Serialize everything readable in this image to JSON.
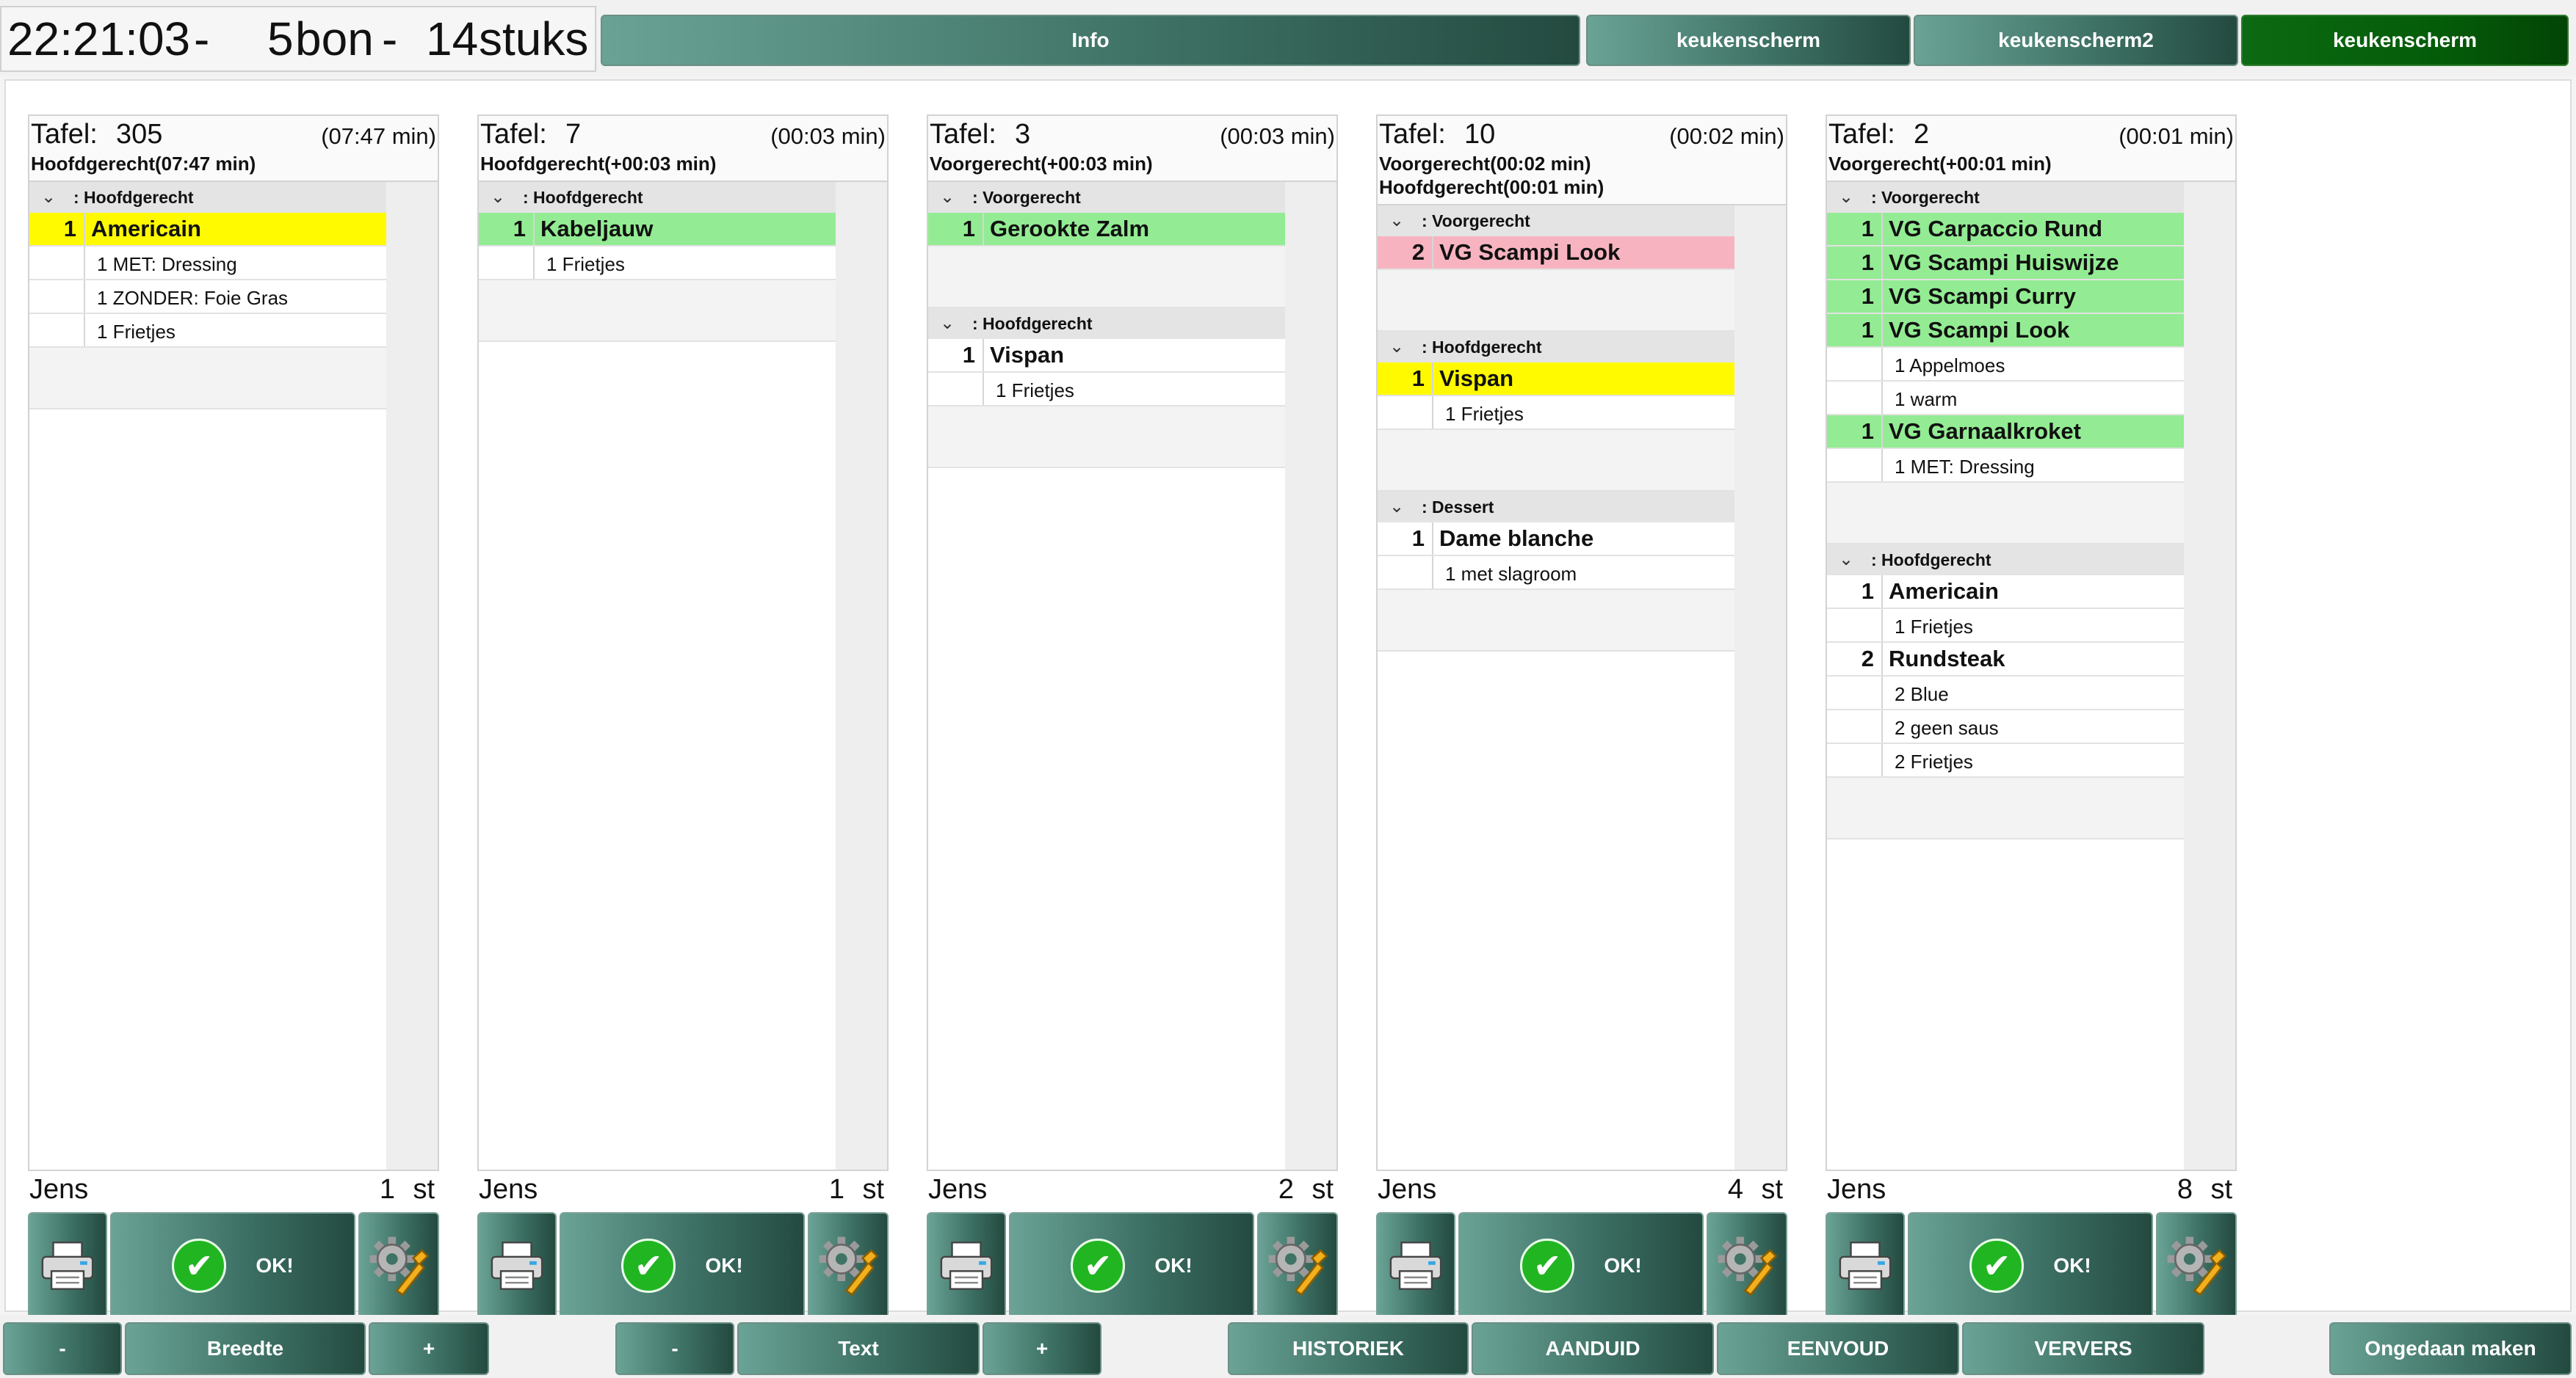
{
  "header": {
    "clock": "22:21:03",
    "dash": "-",
    "bon_count": "5",
    "bon_label": "bon",
    "pieces_count": "14",
    "pieces_label": "stuks",
    "buttons": [
      {
        "label": "Info",
        "active": false
      },
      {
        "label": "keukenscherm",
        "active": false
      },
      {
        "label": "keukenscherm2",
        "active": false
      },
      {
        "label": "keukenscherm",
        "active": true
      }
    ]
  },
  "tickets": [
    {
      "tafel_label": "Tafel:",
      "tafel": "305",
      "elapsed": "(07:47 min)",
      "course_lines": [
        "Hoofdgerecht(07:47 min)"
      ],
      "groups": [
        {
          "title": ": Hoofdgerecht",
          "items": [
            {
              "qty": "1",
              "name": "Americain",
              "highlight": "yellow",
              "subs": [
                "1 MET: Dressing",
                "1 ZONDER: Foie Gras",
                "1 Frietjes"
              ]
            }
          ]
        }
      ],
      "user": "Jens",
      "count": "1",
      "unit": "st",
      "ok_label": "OK!"
    },
    {
      "tafel_label": "Tafel:",
      "tafel": "7",
      "elapsed": "(00:03 min)",
      "course_lines": [
        "Hoofdgerecht(+00:03 min)"
      ],
      "groups": [
        {
          "title": ": Hoofdgerecht",
          "items": [
            {
              "qty": "1",
              "name": "Kabeljauw",
              "highlight": "green",
              "subs": [
                "1 Frietjes"
              ]
            }
          ]
        }
      ],
      "user": "Jens",
      "count": "1",
      "unit": "st",
      "ok_label": "OK!"
    },
    {
      "tafel_label": "Tafel:",
      "tafel": "3",
      "elapsed": "(00:03 min)",
      "course_lines": [
        "Voorgerecht(+00:03 min)"
      ],
      "groups": [
        {
          "title": ": Voorgerecht",
          "items": [
            {
              "qty": "1",
              "name": "Gerookte Zalm",
              "highlight": "green",
              "subs": []
            }
          ]
        },
        {
          "title": ": Hoofdgerecht",
          "items": [
            {
              "qty": "1",
              "name": "Vispan",
              "highlight": "",
              "subs": [
                "1 Frietjes"
              ]
            }
          ]
        }
      ],
      "user": "Jens",
      "count": "2",
      "unit": "st",
      "ok_label": "OK!"
    },
    {
      "tafel_label": "Tafel:",
      "tafel": "10",
      "elapsed": "(00:02 min)",
      "course_lines": [
        "Voorgerecht(00:02 min)",
        "Hoofdgerecht(00:01 min)"
      ],
      "groups": [
        {
          "title": ": Voorgerecht",
          "items": [
            {
              "qty": "2",
              "name": "VG Scampi Look",
              "highlight": "pink",
              "subs": []
            }
          ]
        },
        {
          "title": ": Hoofdgerecht",
          "items": [
            {
              "qty": "1",
              "name": "Vispan",
              "highlight": "yellow",
              "subs": [
                "1 Frietjes"
              ]
            }
          ]
        },
        {
          "title": ": Dessert",
          "items": [
            {
              "qty": "1",
              "name": "Dame blanche",
              "highlight": "",
              "subs": [
                "1 met slagroom"
              ]
            }
          ]
        }
      ],
      "user": "Jens",
      "count": "4",
      "unit": "st",
      "ok_label": "OK!"
    },
    {
      "tafel_label": "Tafel:",
      "tafel": "2",
      "elapsed": "(00:01 min)",
      "course_lines": [
        "Voorgerecht(+00:01 min)"
      ],
      "groups": [
        {
          "title": ": Voorgerecht",
          "items": [
            {
              "qty": "1",
              "name": "VG Carpaccio Rund",
              "highlight": "green",
              "subs": []
            },
            {
              "qty": "1",
              "name": "VG Scampi Huiswijze",
              "highlight": "green",
              "subs": []
            },
            {
              "qty": "1",
              "name": "VG Scampi Curry",
              "highlight": "green",
              "subs": []
            },
            {
              "qty": "1",
              "name": "VG Scampi Look",
              "highlight": "green",
              "subs": [
                "1 Appelmoes",
                "1 warm"
              ]
            },
            {
              "qty": "1",
              "name": "VG Garnaalkroket",
              "highlight": "green",
              "subs": [
                "1 MET: Dressing"
              ]
            }
          ]
        },
        {
          "title": ": Hoofdgerecht",
          "items": [
            {
              "qty": "1",
              "name": "Americain",
              "highlight": "",
              "subs": [
                "1 Frietjes"
              ]
            },
            {
              "qty": "2",
              "name": "Rundsteak",
              "highlight": "",
              "subs": [
                "2 Blue",
                "2 geen saus",
                "2 Frietjes"
              ]
            }
          ]
        }
      ],
      "user": "Jens",
      "count": "8",
      "unit": "st",
      "ok_label": "OK!"
    }
  ],
  "footer": {
    "buttons": [
      {
        "label": "-"
      },
      {
        "label": "Breedte"
      },
      {
        "label": "+"
      },
      {
        "label": "-"
      },
      {
        "label": "Text"
      },
      {
        "label": "+"
      },
      {
        "label": "HISTORIEK"
      },
      {
        "label": "AANDUID"
      },
      {
        "label": "EENVOUD"
      },
      {
        "label": "VERVERS"
      },
      {
        "label": "Ongedaan maken"
      }
    ]
  },
  "icons": {
    "print": "printer-icon",
    "ok": "checkmark-icon",
    "settings": "gear-wrench-icon",
    "collapse": "chevron-down-icon"
  },
  "colors": {
    "highlight_yellow": "#fffa00",
    "highlight_green": "#93ec93",
    "highlight_pink": "#f7b4c0",
    "button_teal": "#3f7366",
    "button_active_green": "#045c09"
  }
}
